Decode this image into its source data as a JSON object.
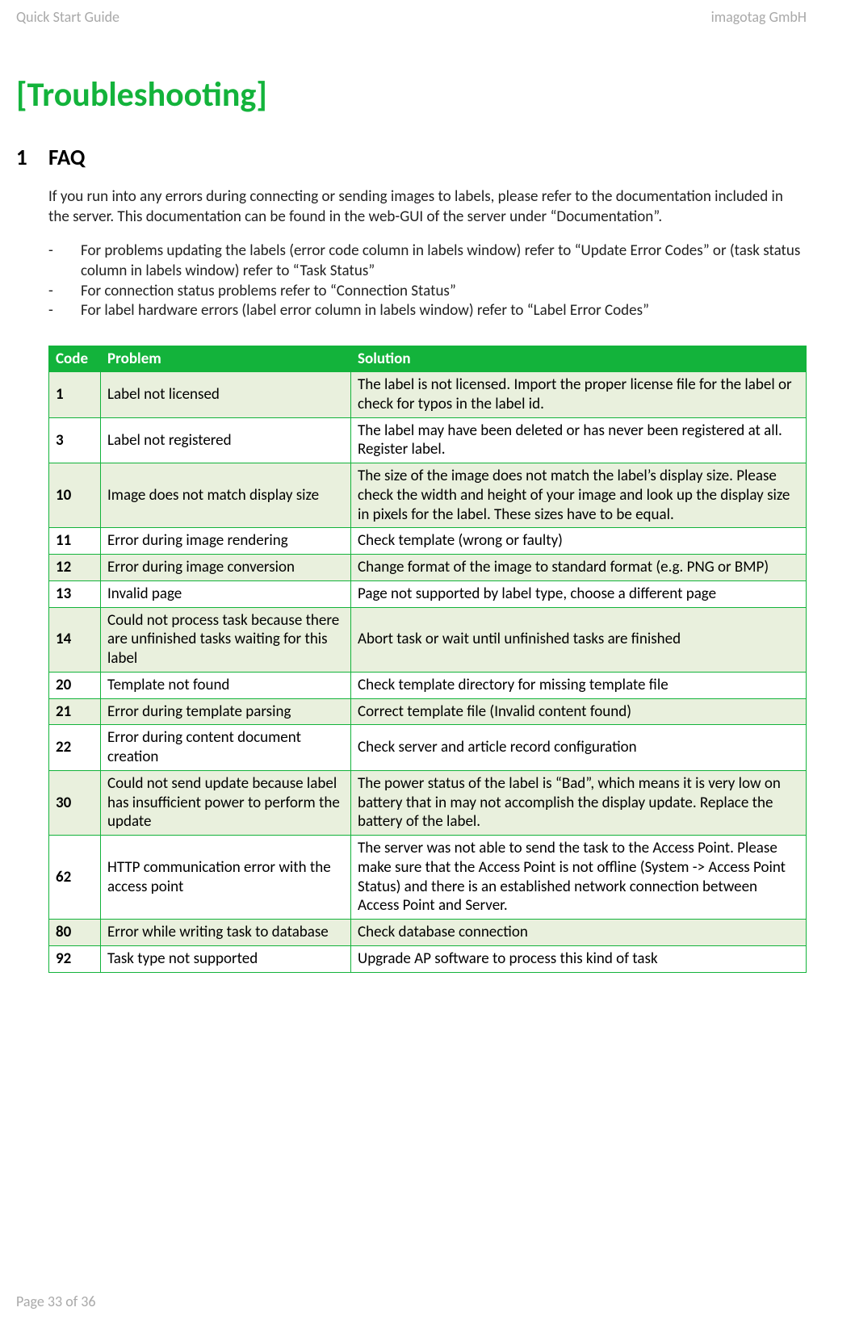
{
  "header": {
    "left": "Quick Start Guide",
    "right": "imagotag GmbH"
  },
  "title": "[Troubleshooting]",
  "section": {
    "number": "1",
    "heading": "FAQ"
  },
  "intro": "If you run into any errors during connecting or sending images to labels, please refer to the documentation included in the server. This documentation can be found in the web-GUI of the server under “Documentation”.",
  "bullets": [
    "For problems updating the labels (error code column in labels window) refer to “Update Error Codes” or (task status column in labels window) refer to “Task Status”",
    "For connection status problems refer to “Connection Status”",
    "For label hardware errors (label error column in labels window) refer to “Label Error Codes”"
  ],
  "table": {
    "headers": [
      "Code",
      "Problem",
      "Solution"
    ],
    "rows": [
      {
        "shade": true,
        "code": "1",
        "problem": "Label not licensed",
        "solution": "The label is not licensed. Import the proper license file for the label or check for typos in the label id."
      },
      {
        "shade": false,
        "code": "3",
        "problem": "Label not registered",
        "solution": "The label may have been deleted or has never been registered at all. Register label."
      },
      {
        "shade": true,
        "code": "10",
        "problem": "Image does not match display size",
        "solution": "The size of the image does not match the label’s display size. Please check the width and height of your image and look up the display size in pixels for the label. These sizes have to be equal."
      },
      {
        "shade": false,
        "code": "11",
        "problem": "Error during image rendering",
        "solution": "Check template (wrong or faulty)"
      },
      {
        "shade": true,
        "code": "12",
        "problem": "Error during image conversion",
        "solution": "Change format of the image to standard format (e.g. PNG or BMP)"
      },
      {
        "shade": false,
        "code": "13",
        "problem": "Invalid page",
        "solution": "Page not supported by label type, choose a different page"
      },
      {
        "shade": true,
        "code": "14",
        "problem": "Could not process task because there are unfinished tasks waiting for this label",
        "solution": "Abort task or wait until unfinished tasks are finished"
      },
      {
        "shade": false,
        "code": "20",
        "problem": "Template not found",
        "solution": "Check template directory for missing template file"
      },
      {
        "shade": true,
        "code": "21",
        "problem": "Error during template parsing",
        "solution": "Correct template file (Invalid content found)"
      },
      {
        "shade": false,
        "code": "22",
        "problem": "Error during content document creation",
        "solution": "Check server and article record configuration"
      },
      {
        "shade": true,
        "code": "30",
        "problem": "Could not send update because label has insufficient power to perform the update",
        "solution": "The power status of the label is “Bad”, which means it is very low on battery that in may not accomplish the display update. Replace the battery of the label."
      },
      {
        "shade": false,
        "code": "62",
        "problem": "HTTP communication error with the access point",
        "solution": "The server was not able to send the task to the Access Point. Please make sure that the Access Point is not offline (System -> Access Point Status) and there is an established network connection between Access Point and Server."
      },
      {
        "shade": true,
        "code": "80",
        "problem": "Error while writing task to database",
        "solution": "Check database connection"
      },
      {
        "shade": false,
        "code": "92",
        "problem": "Task type not supported",
        "solution": "Upgrade AP software to process this kind of task"
      }
    ]
  },
  "footer": "Page 33 of 36"
}
